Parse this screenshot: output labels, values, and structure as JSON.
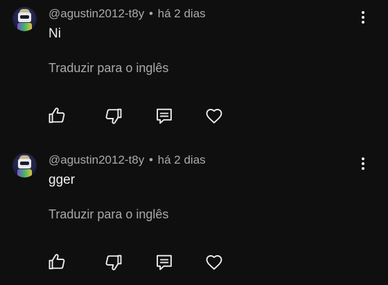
{
  "comments": [
    {
      "author": "@agustin2012-t8y",
      "separator": "•",
      "time": "há 2 dias",
      "text": "Ni",
      "translate_label": "Traduzir para o inglês"
    },
    {
      "author": "@agustin2012-t8y",
      "separator": "•",
      "time": "há 2 dias",
      "text": "gger",
      "translate_label": "Traduzir para o inglês"
    }
  ],
  "icons": {
    "like": "thumb-up-icon",
    "dislike": "thumb-down-icon",
    "reply": "comment-icon",
    "heart": "heart-icon",
    "more": "more-vertical-icon"
  },
  "colors": {
    "background": "#0f0f0f",
    "primary_text": "#f1f1f1",
    "secondary_text": "#aaaaaa"
  }
}
